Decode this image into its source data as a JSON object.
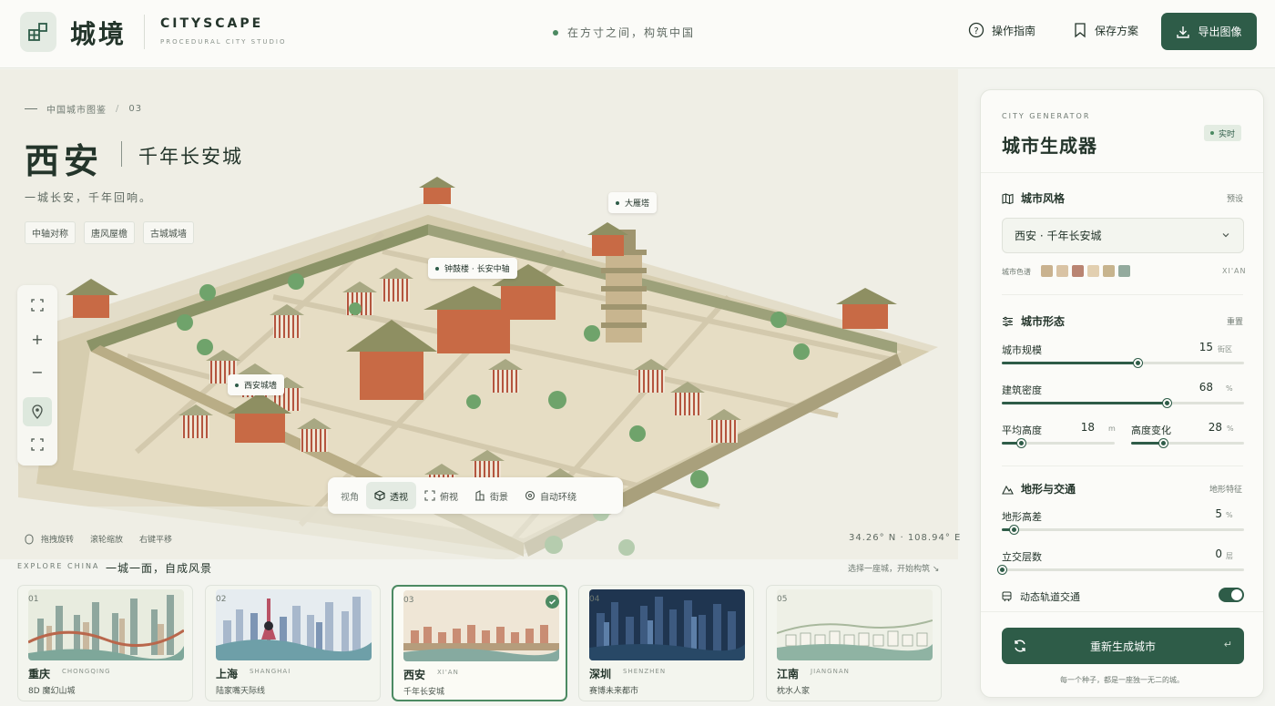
{
  "header": {
    "logo_cn": "城境",
    "logo_en": "CITYSCAPE",
    "logo_sub": "PROCEDURAL CITY STUDIO",
    "tagline": "在方寸之间，构筑中国",
    "guide_label": "操作指南",
    "save_label": "保存方案",
    "export_label": "导出图像"
  },
  "stage": {
    "breadcrumb": "中国城市图鉴",
    "breadcrumb_index": "03",
    "city": "西安",
    "city_sub": "千年长安城",
    "motto": "一城长安，千年回响。",
    "tags": [
      "中轴对称",
      "唐风屋檐",
      "古城城墙"
    ],
    "map_labels": {
      "pagoda": "大雁塔",
      "axis": "钟鼓楼 · 长安中轴",
      "wall": "西安城墙"
    },
    "view_label": "视角",
    "views": [
      "透视",
      "俯视",
      "街景",
      "自动环绕"
    ],
    "active_view": "透视",
    "hints": [
      "拖拽旋转",
      "滚轮缩放",
      "右键平移"
    ],
    "coords": "34.26° N · 108.94° E"
  },
  "explore": {
    "title_en": "EXPLORE CHINA",
    "title_cn": "一城一面，自成风景",
    "hint": "选择一座城，开始构筑 ↘",
    "cards": [
      {
        "num": "01",
        "cn": "重庆",
        "en": "CHONGQING",
        "desc": "8D 魔幻山城"
      },
      {
        "num": "02",
        "cn": "上海",
        "en": "SHANGHAI",
        "desc": "陆家嘴天际线"
      },
      {
        "num": "03",
        "cn": "西安",
        "en": "XI'AN",
        "desc": "千年长安城",
        "selected": true
      },
      {
        "num": "04",
        "cn": "深圳",
        "en": "SHENZHEN",
        "desc": "赛博未来都市"
      },
      {
        "num": "05",
        "cn": "江南",
        "en": "JIANGNAN",
        "desc": "枕水人家"
      }
    ]
  },
  "panel": {
    "title_en": "CITY GENERATOR",
    "title": "城市生成器",
    "live_badge": "实时",
    "style_section": "城市风格",
    "style_action": "预设",
    "style_select": "西安 · 千年长安城",
    "palette_label": "城市色谱",
    "palette_code": "XI'AN",
    "palette": [
      "#c9b28f",
      "#d9c3a4",
      "#b98472",
      "#e2cfb0",
      "#c7b48e",
      "#93aa9d"
    ],
    "form_section": "城市形态",
    "form_action": "重置",
    "scale": {
      "label": "城市规模",
      "value": "15",
      "unit": "街区",
      "fraction": 0.56
    },
    "density": {
      "label": "建筑密度",
      "value": "68",
      "unit": "%",
      "fraction": 0.68
    },
    "height": {
      "label": "平均高度",
      "value": "18",
      "unit": "m",
      "fraction": 0.17
    },
    "height_var": {
      "label": "高度变化",
      "value": "28",
      "unit": "%",
      "fraction": 0.28
    },
    "terrain_section": "地形与交通",
    "terrain_action": "地形特征",
    "terrain": {
      "label": "地形高差",
      "value": "5",
      "unit": "%",
      "fraction": 0.05
    },
    "layers": {
      "label": "立交层数",
      "value": "0",
      "unit": "层",
      "fraction": 0.0
    },
    "transit_label": "动态轨道交通",
    "transit_on": true,
    "regen_label": "重新生成城市",
    "footer": "每一个种子，都是一座独一无二的城。"
  }
}
